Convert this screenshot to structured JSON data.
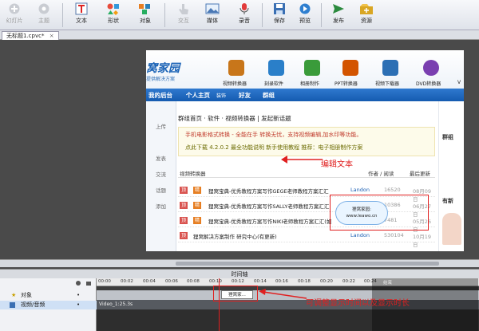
{
  "toolbar": {
    "buttons": [
      {
        "label": "幻灯片",
        "icon": "add-slide-icon",
        "enabled": false
      },
      {
        "label": "主题",
        "icon": "theme-icon",
        "enabled": false
      },
      {
        "label": "文本",
        "icon": "text-icon",
        "enabled": true
      },
      {
        "label": "形状",
        "icon": "shapes-icon",
        "enabled": true
      },
      {
        "label": "对象",
        "icon": "object-icon",
        "enabled": true
      },
      {
        "label": "交互",
        "icon": "interaction-icon",
        "enabled": false
      },
      {
        "label": "媒体",
        "icon": "image-icon",
        "enabled": true
      },
      {
        "label": "录音",
        "icon": "microphone-icon",
        "enabled": true
      },
      {
        "label": "保存",
        "icon": "save-icon",
        "enabled": true
      },
      {
        "label": "预览",
        "icon": "preview-icon",
        "enabled": true
      },
      {
        "label": "发布",
        "icon": "publish-icon",
        "enabled": true
      },
      {
        "label": "资源",
        "icon": "resources-icon",
        "enabled": true
      }
    ]
  },
  "tabs": [
    {
      "label": "无标题1.cpvc*"
    }
  ],
  "site": {
    "logo": "窝家园",
    "logo_sub": "提供解决方案",
    "nav_icons": [
      {
        "label": "视频转换器",
        "color": "#c8761a"
      },
      {
        "label": "刻录软件",
        "color": "#2a7fc9"
      },
      {
        "label": "相册制作",
        "color": "#3a9b3a"
      },
      {
        "label": "PPT转换器",
        "color": "#d35400"
      },
      {
        "label": "视频下载器",
        "color": "#2c6fb4"
      },
      {
        "label": "DVD转换器",
        "color": "#7a3fb0"
      },
      {
        "label": "V",
        "color": "#444444"
      }
    ],
    "blue_nav": [
      "我的后台",
      "个人主页",
      "装饰",
      "好友",
      "群组"
    ],
    "left_col": [
      "上传",
      "发表",
      "交流",
      "话题",
      "添加"
    ],
    "breadcrumb": "群组首页 · 软件 · 视频转换器 | 发起新话题",
    "promo_lines": [
      "手机电影格式转换 - 全能在手 转换无忧，支持视频编辑,加水印等功能。",
      "点此下载 4.2.0.2 最全功能说明 新手使用教程 推荐：电子相册制作方案"
    ],
    "table_headers": {
      "title": "视频转换器",
      "author": "作者 / 阅读",
      "updated": "最后更新"
    },
    "rows": [
      {
        "tag": "顶",
        "tag2": "精",
        "title": "狸窝宝典-优秀教程方案写作GEGE老师教程方案汇汇",
        "author": "Landon",
        "reads": "16520",
        "date": "08月09日"
      },
      {
        "tag": "顶",
        "tag2": "精",
        "title": "狸窝宝典-优秀教程方案写作SALLY老师教程方案汇汇",
        "author": "二阿",
        "reads": "10386",
        "date": "06月27日"
      },
      {
        "tag": "顶",
        "tag2": "精",
        "title": "狸窝宝典-优秀教程方案写作NIKI老师教程方案汇汇(如",
        "author": "二阿",
        "reads": "7481",
        "date": "05月26日"
      },
      {
        "tag": "顶",
        "tag2": "",
        "title": "狸窝解决方案制作 研究中心(有更新)",
        "author": "Landon",
        "reads": "530104",
        "date": "10月19日"
      }
    ],
    "right_col": [
      "群组",
      "有新"
    ]
  },
  "callout": {
    "text": "狸窝家园: www.leawo.cn",
    "edit_label": "编辑文本"
  },
  "timeline": {
    "title": "时间轴",
    "layers": [
      {
        "label": "对象"
      },
      {
        "label": "视频/音频"
      }
    ],
    "ticks": [
      "00:00",
      "00:02",
      "00:04",
      "00:06",
      "00:08",
      "00:10",
      "00:12",
      "00:14",
      "00:16",
      "00:18",
      "00:20",
      "00:22",
      "00:24"
    ],
    "clip_label": "狸窝家...",
    "video_clip": "Video_1:25.3s",
    "end_label": "结束",
    "note": "可调整显示时间以及显示时长"
  }
}
